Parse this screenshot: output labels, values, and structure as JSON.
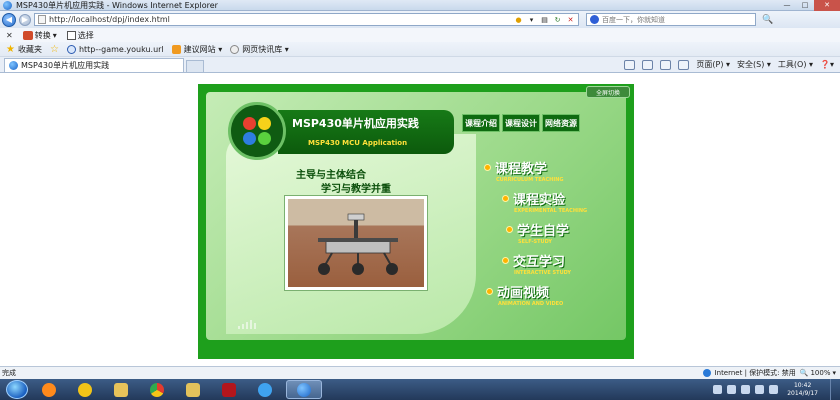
{
  "window": {
    "title": "MSP430单片机应用实践 - Windows Internet Explorer",
    "min": "—",
    "max": "□",
    "close": "✕"
  },
  "address": {
    "url": "http://localhost/dpj/index.html",
    "search_placeholder": "百度一下，你就知道",
    "search_go": "🔍"
  },
  "menurow": {
    "convert": "转换",
    "select": "选择"
  },
  "favorites": {
    "favorites_label": "收藏夹",
    "items": [
      "http--game.youku.url",
      "建议网站 ▾",
      "网页快讯库 ▾"
    ]
  },
  "tab": {
    "label": "MSP430单片机应用实践"
  },
  "commandbar": {
    "page": "页面(P) ▾",
    "safety": "安全(S) ▾",
    "tools": "工具(O) ▾",
    "help": "❓▾"
  },
  "flash": {
    "fullscreen": "全屏切换",
    "title_cn": "MSP430单片机应用实践",
    "title_en": "MSP430 MCU Application",
    "top_tabs": [
      "课程介绍",
      "课程设计",
      "网络资源"
    ],
    "slogan_line1": "主导与主体结合",
    "slogan_line2": "学习与教学并重",
    "courses": [
      {
        "cn": "课程教学",
        "en": "CURRICULUM TEACHING"
      },
      {
        "cn": "课程实验",
        "en": "EXPERIMENTAL TEACHING"
      },
      {
        "cn": "学生自学",
        "en": "SELF-STUDY"
      },
      {
        "cn": "交互学习",
        "en": "INTERACTIVE STUDY"
      },
      {
        "cn": "动画视频",
        "en": "ANIMATION AND VIDEO"
      }
    ]
  },
  "statusbar": {
    "status": "完成",
    "zone": "Internet | 保护模式: 禁用",
    "zoom": "100%"
  },
  "taskbar": {
    "time": "10:42",
    "date": "2014/9/17"
  },
  "colors": {
    "flash_green": "#1e9f1c",
    "accent_yellow": "#ffe03a",
    "bullet_orange": "#ffb300"
  }
}
